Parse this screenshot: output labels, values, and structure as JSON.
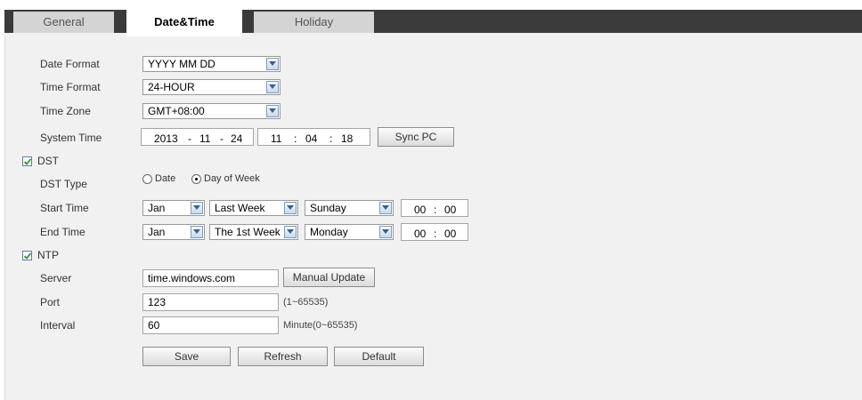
{
  "tabs": [
    {
      "label": "General",
      "active": false
    },
    {
      "label": "Date&Time",
      "active": true
    },
    {
      "label": "Holiday",
      "active": false
    }
  ],
  "form": {
    "date_format": {
      "label": "Date Format",
      "value": "YYYY MM DD"
    },
    "time_format": {
      "label": "Time Format",
      "value": "24-HOUR"
    },
    "time_zone": {
      "label": "Time Zone",
      "value": "GMT+08:00"
    },
    "system_time": {
      "label": "System Time",
      "year": "2013",
      "month": "11",
      "day": "24",
      "hour": "11",
      "minute": "04",
      "second": "18",
      "date_sep": "-",
      "time_sep": ":",
      "sync_button": "Sync PC"
    },
    "dst": {
      "label": "DST",
      "checked": true,
      "type_label": "DST Type",
      "type_options": [
        "Date",
        "Day of Week"
      ],
      "type_selected": "Day of Week",
      "start": {
        "label": "Start Time",
        "month": "Jan",
        "week": "Last Week",
        "day": "Sunday",
        "hour": "00",
        "minute": "00"
      },
      "end": {
        "label": "End Time",
        "month": "Jan",
        "week": "The 1st Week",
        "day": "Monday",
        "hour": "00",
        "minute": "00"
      },
      "time_sep": ":"
    },
    "ntp": {
      "label": "NTP",
      "checked": true,
      "server_label": "Server",
      "server": "time.windows.com",
      "manual_update": "Manual Update",
      "port_label": "Port",
      "port": "123",
      "port_hint": "(1~65535)",
      "interval_label": "Interval",
      "interval": "60",
      "interval_hint": "Minute(0~65535)"
    }
  },
  "buttons": {
    "save": "Save",
    "refresh": "Refresh",
    "default": "Default"
  },
  "colors": {
    "tabbar": "#3b3b3b",
    "panel": "#f1f1f1",
    "checkbox_mark": "#2a8a2a"
  }
}
